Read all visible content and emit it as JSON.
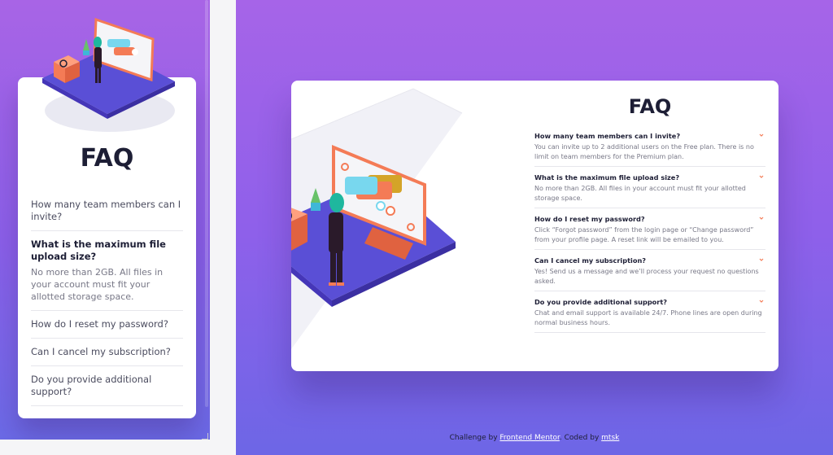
{
  "title": "FAQ",
  "faq": [
    {
      "question": "How many team members can I invite?",
      "answer": "You can invite up to 2 additional users on the Free plan. There is no limit on team members for the Premium plan."
    },
    {
      "question": "What is the maximum file upload size?",
      "answer": "No more than 2GB. All files in your account must fit your allotted storage space."
    },
    {
      "question": "How do I reset my password?",
      "answer": "Click “Forgot password” from the login page or “Change password” from your profile page. A reset link will be emailed to you."
    },
    {
      "question": "Can I cancel my subscription?",
      "answer": "Yes! Send us a message and we’ll process your request no questions asked."
    },
    {
      "question": "Do you provide additional support?",
      "answer": "Chat and email support is available 24/7. Phone lines are open during normal business hours."
    }
  ],
  "mobile": {
    "title": "FAQ",
    "questions": [
      "How many team members can I invite?",
      "What is the maximum file upload size?",
      "How do I reset my password?",
      "Can I cancel my subscription?",
      "Do you provide additional support?"
    ],
    "open_answer": "No more than 2GB. All files in your account must fit your allotted storage space."
  },
  "attribution": {
    "prefix": "Challenge by ",
    "link1": "Frontend Mentor",
    "middle": ". Coded by ",
    "link2": "mtsk"
  },
  "colors": {
    "gradient_top": "#a864e6",
    "gradient_bottom": "#6b6ae6",
    "heading": "#1d1e35",
    "text_muted": "#787887",
    "accent": "#f47b56"
  },
  "icons": [
    "chevron-down-icon",
    "woman-online-illustration",
    "box-illustration"
  ]
}
